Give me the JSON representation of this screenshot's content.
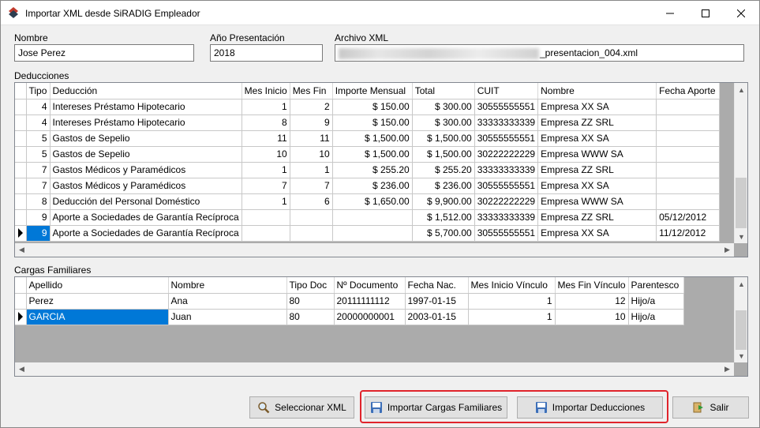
{
  "window": {
    "title": "Importar XML desde SiRADIG Empleador"
  },
  "fields": {
    "nombre_label": "Nombre",
    "nombre_value": "Jose Perez",
    "anio_label": "Año Presentación",
    "anio_value": "2018",
    "archivo_label": "Archivo XML",
    "archivo_value_suffix": "_presentacion_004.xml"
  },
  "deducciones": {
    "label": "Deducciones",
    "columns": [
      "Tipo",
      "Deducción",
      "Mes Inicio",
      "Mes Fin",
      "Importe Mensual",
      "Total",
      "CUIT",
      "Nombre",
      "Fecha Aporte"
    ],
    "rows": [
      [
        "4",
        "Intereses Préstamo Hipotecario",
        "1",
        "2",
        "$ 150.00",
        "$ 300.00",
        "30555555551",
        "Empresa XX SA",
        ""
      ],
      [
        "4",
        "Intereses Préstamo Hipotecario",
        "8",
        "9",
        "$ 150.00",
        "$ 300.00",
        "33333333339",
        "Empresa ZZ SRL",
        ""
      ],
      [
        "5",
        "Gastos de Sepelio",
        "11",
        "11",
        "$ 1,500.00",
        "$ 1,500.00",
        "30555555551",
        "Empresa XX SA",
        ""
      ],
      [
        "5",
        "Gastos de Sepelio",
        "10",
        "10",
        "$ 1,500.00",
        "$ 1,500.00",
        "30222222229",
        "Empresa WWW SA",
        ""
      ],
      [
        "7",
        "Gastos Médicos y Paramédicos",
        "1",
        "1",
        "$ 255.20",
        "$ 255.20",
        "33333333339",
        "Empresa ZZ SRL",
        ""
      ],
      [
        "7",
        "Gastos Médicos y Paramédicos",
        "7",
        "7",
        "$ 236.00",
        "$ 236.00",
        "30555555551",
        "Empresa XX SA",
        ""
      ],
      [
        "8",
        "Deducción del Personal Doméstico",
        "1",
        "6",
        "$ 1,650.00",
        "$ 9,900.00",
        "30222222229",
        "Empresa WWW SA",
        ""
      ],
      [
        "9",
        "Aporte a Sociedades de Garantía Recíproca",
        "",
        "",
        "",
        "$ 1,512.00",
        "33333333339",
        "Empresa ZZ SRL",
        "05/12/2012"
      ],
      [
        "9",
        "Aporte a Sociedades de Garantía Recíproca",
        "",
        "",
        "",
        "$ 5,700.00",
        "30555555551",
        "Empresa XX SA",
        "11/12/2012"
      ]
    ]
  },
  "cargas": {
    "label": "Cargas Familiares",
    "columns": [
      "Apellido",
      "Nombre",
      "Tipo Doc",
      "Nº Documento",
      "Fecha Nac.",
      "Mes Inicio Vínculo",
      "Mes Fin Vínculo",
      "Parentesco"
    ],
    "rows": [
      [
        "Perez",
        "Ana",
        "80",
        "20111111112",
        "1997-01-15",
        "1",
        "12",
        "Hijo/a"
      ],
      [
        "GARCIA",
        "Juan",
        "80",
        "20000000001",
        "2003-01-15",
        "1",
        "10",
        "Hijo/a"
      ]
    ]
  },
  "buttons": {
    "seleccionar": "Seleccionar XML",
    "importar_cargas": "Importar Cargas Familiares",
    "importar_deducciones": "Importar Deducciones",
    "salir": "Salir"
  },
  "colors": {
    "selection": "#0078d7",
    "highlight": "#e0242c"
  }
}
